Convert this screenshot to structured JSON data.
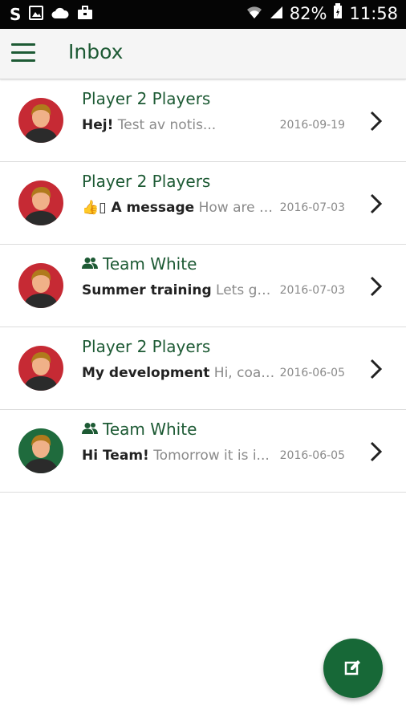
{
  "status_bar": {
    "icons": [
      "s-notification-icon",
      "image-icon",
      "cloud-icon",
      "briefcase-icon",
      "wifi-icon",
      "signal-icon",
      "battery-icon"
    ],
    "battery": "82%",
    "time": "11:58"
  },
  "app_bar": {
    "title": "Inbox",
    "menu_icon": "hamburger-icon"
  },
  "colors": {
    "brand_green": "#1d5a34",
    "fab_green": "#176837",
    "avatar_red": "#c62a34",
    "avatar_green": "#1f6b3d"
  },
  "messages": [
    {
      "sender": "Player 2 Players",
      "group_icon": false,
      "subject": "Hej!",
      "snippet": "Test av notis...",
      "date": "2016-09-19",
      "avatar": "red"
    },
    {
      "sender": "Player 2 Players",
      "group_icon": false,
      "subject": "👍▯ A message",
      "snippet": "How are you?",
      "date": "2016-07-03",
      "avatar": "red"
    },
    {
      "sender": "Team White",
      "group_icon": true,
      "subject": "Summer training",
      "snippet": "Lets go!...",
      "date": "2016-07-03",
      "avatar": "red"
    },
    {
      "sender": "Player 2 Players",
      "group_icon": false,
      "subject": "My development",
      "snippet": "Hi, coach...",
      "date": "2016-06-05",
      "avatar": "red"
    },
    {
      "sender": "Team White",
      "group_icon": true,
      "subject": "Hi Team!",
      "snippet": "Tomorrow it is i...",
      "date": "2016-06-05",
      "avatar": "green"
    }
  ],
  "fab": {
    "icon": "compose-icon"
  }
}
